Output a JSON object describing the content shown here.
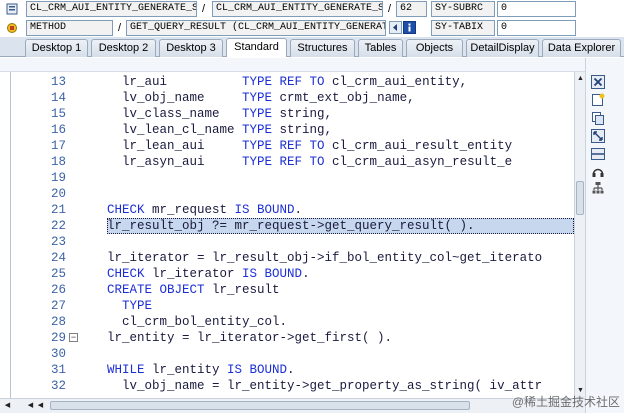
{
  "header": {
    "row1": {
      "program": "CL_CRM_AUI_ENTITY_GENERATE_SR...",
      "include": "CL_CRM_AUI_ENTITY_GENERATE_SR...",
      "line": "62",
      "var_name": "SY-SUBRC",
      "var_value": "0"
    },
    "row2": {
      "type": "METHOD",
      "method": "GET_QUERY_RESULT (CL_CRM_AUI_ENTITY_GENERAT...",
      "var_name": "SY-TABIX",
      "var_value": "0"
    }
  },
  "tabs": [
    {
      "label": "Desktop 1"
    },
    {
      "label": "Desktop 2"
    },
    {
      "label": "Desktop 3"
    },
    {
      "label": "Standard"
    },
    {
      "label": "Structures"
    },
    {
      "label": "Tables"
    },
    {
      "label": "Objects"
    },
    {
      "label": "DetailDisplay"
    },
    {
      "label": "Data Explorer"
    }
  ],
  "active_tab": "Standard",
  "code_lines": [
    {
      "n": "13",
      "text": "  lr_aui          TYPE REF TO cl_crm_aui_entity,"
    },
    {
      "n": "14",
      "text": "  lv_obj_name     TYPE crmt_ext_obj_name,"
    },
    {
      "n": "15",
      "text": "  lv_class_name   TYPE string,"
    },
    {
      "n": "16",
      "text": "  lv_lean_cl_name TYPE string,"
    },
    {
      "n": "17",
      "text": "  lr_lean_aui     TYPE REF TO cl_crm_aui_result_entity"
    },
    {
      "n": "18",
      "text": "  lr_asyn_aui     TYPE REF TO cl_crm_aui_asyn_result_e"
    },
    {
      "n": "19",
      "text": ""
    },
    {
      "n": "20",
      "text": ""
    },
    {
      "n": "21",
      "text": "CHECK mr_request IS BOUND."
    },
    {
      "n": "22",
      "text": "lr_result_obj ?= mr_request->get_query_result( )."
    },
    {
      "n": "23",
      "text": ""
    },
    {
      "n": "24",
      "text": "lr_iterator = lr_result_obj->if_bol_entity_col~get_iterato"
    },
    {
      "n": "25",
      "text": "CHECK lr_iterator IS BOUND."
    },
    {
      "n": "26",
      "text": "CREATE OBJECT lr_result"
    },
    {
      "n": "27",
      "text": "  TYPE"
    },
    {
      "n": "28",
      "text": "  cl_crm_bol_entity_col."
    },
    {
      "n": "29",
      "text": "lr_entity = lr_iterator->get_first( )."
    },
    {
      "n": "30",
      "text": ""
    },
    {
      "n": "31",
      "text": "WHILE lr_entity IS BOUND."
    },
    {
      "n": "32",
      "text": "  lv_obj_name = lr_entity->get_property_as_string( iv_attr"
    }
  ],
  "current_line": "22",
  "watermark": "@稀土掘金技术社区",
  "colors": {
    "keyword": "#1c2fd6",
    "line_number": "#3c63a8",
    "highlight": "#c7d7ee",
    "tab_bar": "#dbe4ee"
  },
  "icons": [
    "close-icon",
    "new-icon",
    "copy-icon",
    "expand-icon",
    "split-icon",
    "headset-icon",
    "tree-icon",
    "info-icon",
    "back-icon"
  ]
}
